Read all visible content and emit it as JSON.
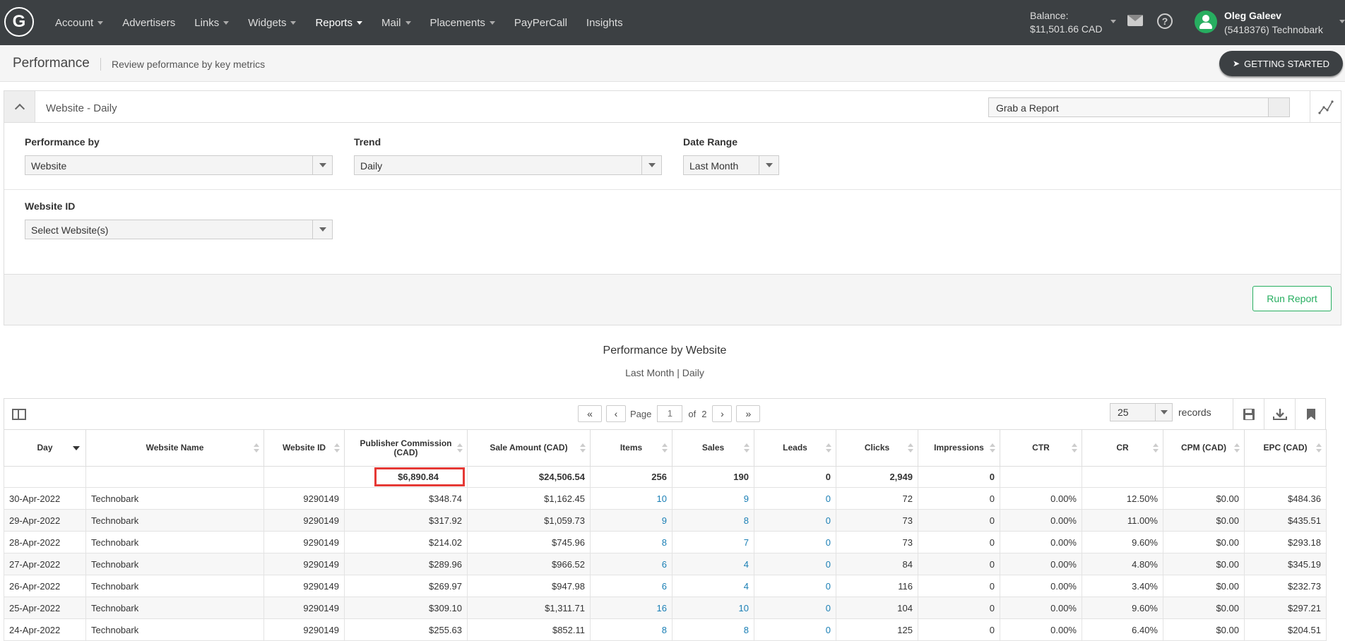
{
  "nav": {
    "logo": "G",
    "items": [
      {
        "label": "Account",
        "dropdown": true
      },
      {
        "label": "Advertisers",
        "dropdown": false
      },
      {
        "label": "Links",
        "dropdown": true
      },
      {
        "label": "Widgets",
        "dropdown": true
      },
      {
        "label": "Reports",
        "dropdown": true,
        "active": true
      },
      {
        "label": "Mail",
        "dropdown": true
      },
      {
        "label": "Placements",
        "dropdown": true
      },
      {
        "label": "PayPerCall",
        "dropdown": false
      },
      {
        "label": "Insights",
        "dropdown": false
      }
    ],
    "balance_label": "Balance:",
    "balance_value": "$11,501.66 CAD",
    "user_name": "Oleg Galeev",
    "user_account": "(5418376) Technobark"
  },
  "page": {
    "title": "Performance",
    "subtitle": "Review peformance by key metrics",
    "getting_started": "GETTING STARTED"
  },
  "panel": {
    "title": "Website - Daily",
    "grab_report": "Grab a Report",
    "performance_by_label": "Performance by",
    "performance_by_value": "Website",
    "trend_label": "Trend",
    "trend_value": "Daily",
    "date_range_label": "Date Range",
    "date_range_value": "Last Month",
    "website_id_label": "Website ID",
    "website_id_value": "Select Website(s)",
    "run_report": "Run Report"
  },
  "report": {
    "title": "Performance by Website",
    "subtitle": "Last Month | Daily"
  },
  "pager": {
    "page_label": "Page",
    "current_page": "1",
    "of_label": "of",
    "total_pages": "2",
    "records_value": "25",
    "records_label": "records"
  },
  "table": {
    "columns": [
      "Day",
      "Website Name",
      "Website ID",
      "Publisher Commission (CAD)",
      "Sale Amount (CAD)",
      "Items",
      "Sales",
      "Leads",
      "Clicks",
      "Impressions",
      "CTR",
      "CR",
      "CPM (CAD)",
      "EPC (CAD)"
    ],
    "totals": [
      "",
      "",
      "",
      "$6,890.84",
      "$24,506.54",
      "256",
      "190",
      "0",
      "2,949",
      "0",
      "",
      "",
      "",
      ""
    ],
    "rows": [
      [
        "30-Apr-2022",
        "Technobark",
        "9290149",
        "$348.74",
        "$1,162.45",
        "10",
        "9",
        "0",
        "72",
        "0",
        "0.00%",
        "12.50%",
        "$0.00",
        "$484.36"
      ],
      [
        "29-Apr-2022",
        "Technobark",
        "9290149",
        "$317.92",
        "$1,059.73",
        "9",
        "8",
        "0",
        "73",
        "0",
        "0.00%",
        "11.00%",
        "$0.00",
        "$435.51"
      ],
      [
        "28-Apr-2022",
        "Technobark",
        "9290149",
        "$214.02",
        "$745.96",
        "8",
        "7",
        "0",
        "73",
        "0",
        "0.00%",
        "9.60%",
        "$0.00",
        "$293.18"
      ],
      [
        "27-Apr-2022",
        "Technobark",
        "9290149",
        "$289.96",
        "$966.52",
        "6",
        "4",
        "0",
        "84",
        "0",
        "0.00%",
        "4.80%",
        "$0.00",
        "$345.19"
      ],
      [
        "26-Apr-2022",
        "Technobark",
        "9290149",
        "$269.97",
        "$947.98",
        "6",
        "4",
        "0",
        "116",
        "0",
        "0.00%",
        "3.40%",
        "$0.00",
        "$232.73"
      ],
      [
        "25-Apr-2022",
        "Technobark",
        "9290149",
        "$309.10",
        "$1,311.71",
        "16",
        "10",
        "0",
        "104",
        "0",
        "0.00%",
        "9.60%",
        "$0.00",
        "$297.21"
      ],
      [
        "24-Apr-2022",
        "Technobark",
        "9290149",
        "$255.63",
        "$852.11",
        "8",
        "8",
        "0",
        "125",
        "0",
        "0.00%",
        "6.40%",
        "$0.00",
        "$204.51"
      ]
    ]
  },
  "colors": {
    "topbar": "#3c4043",
    "accent_green": "#27ae60",
    "link_blue": "#1a7fb5",
    "highlight_red": "#e53935"
  }
}
